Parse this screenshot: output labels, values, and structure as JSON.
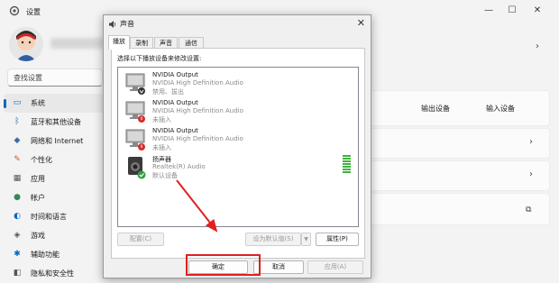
{
  "settings": {
    "title": "设置",
    "search_placeholder": "查找设置",
    "window_controls": {
      "minimize": "—",
      "maximize": "☐",
      "close": "✕"
    },
    "nav": [
      {
        "label": "系统",
        "icon": "monitor-icon",
        "selected": true
      },
      {
        "label": "蓝牙和其他设备",
        "icon": "bluetooth-icon"
      },
      {
        "label": "网络和 Internet",
        "icon": "wifi-icon"
      },
      {
        "label": "个性化",
        "icon": "brush-icon"
      },
      {
        "label": "应用",
        "icon": "apps-icon"
      },
      {
        "label": "帐户",
        "icon": "person-icon"
      },
      {
        "label": "时间和语言",
        "icon": "globe-icon"
      },
      {
        "label": "游戏",
        "icon": "gamepad-icon"
      },
      {
        "label": "辅助功能",
        "icon": "accessibility-icon"
      },
      {
        "label": "隐私和安全性",
        "icon": "shield-icon"
      }
    ],
    "output_device_label": "输出设备",
    "input_device_label": "输入设备",
    "chevron": "›",
    "external_link": "⧉"
  },
  "dialog": {
    "title": "声音",
    "close": "✕",
    "tabs": [
      "播放",
      "录制",
      "声音",
      "通信"
    ],
    "instruction": "选择以下播放设备来修改设置:",
    "devices": [
      {
        "name": "NVIDIA Output",
        "desc": "NVIDIA High Definition Audio",
        "status": "禁用、拔出",
        "type": "monitor",
        "badge": "down"
      },
      {
        "name": "NVIDIA Output",
        "desc": "NVIDIA High Definition Audio",
        "status": "未插入",
        "type": "monitor",
        "badge": "red"
      },
      {
        "name": "NVIDIA Output",
        "desc": "NVIDIA High Definition Audio",
        "status": "未插入",
        "type": "monitor",
        "badge": "red"
      },
      {
        "name": "扬声器",
        "desc": "Realtek(R) Audio",
        "status": "默认设备",
        "type": "speaker",
        "badge": "green"
      }
    ],
    "buttons": {
      "configure": "配置(C)",
      "set_default": "设为默认值(S)",
      "set_default_arrow": "▼",
      "properties": "属性(P)",
      "ok": "确定",
      "cancel": "取消",
      "apply": "应用(A)"
    }
  }
}
